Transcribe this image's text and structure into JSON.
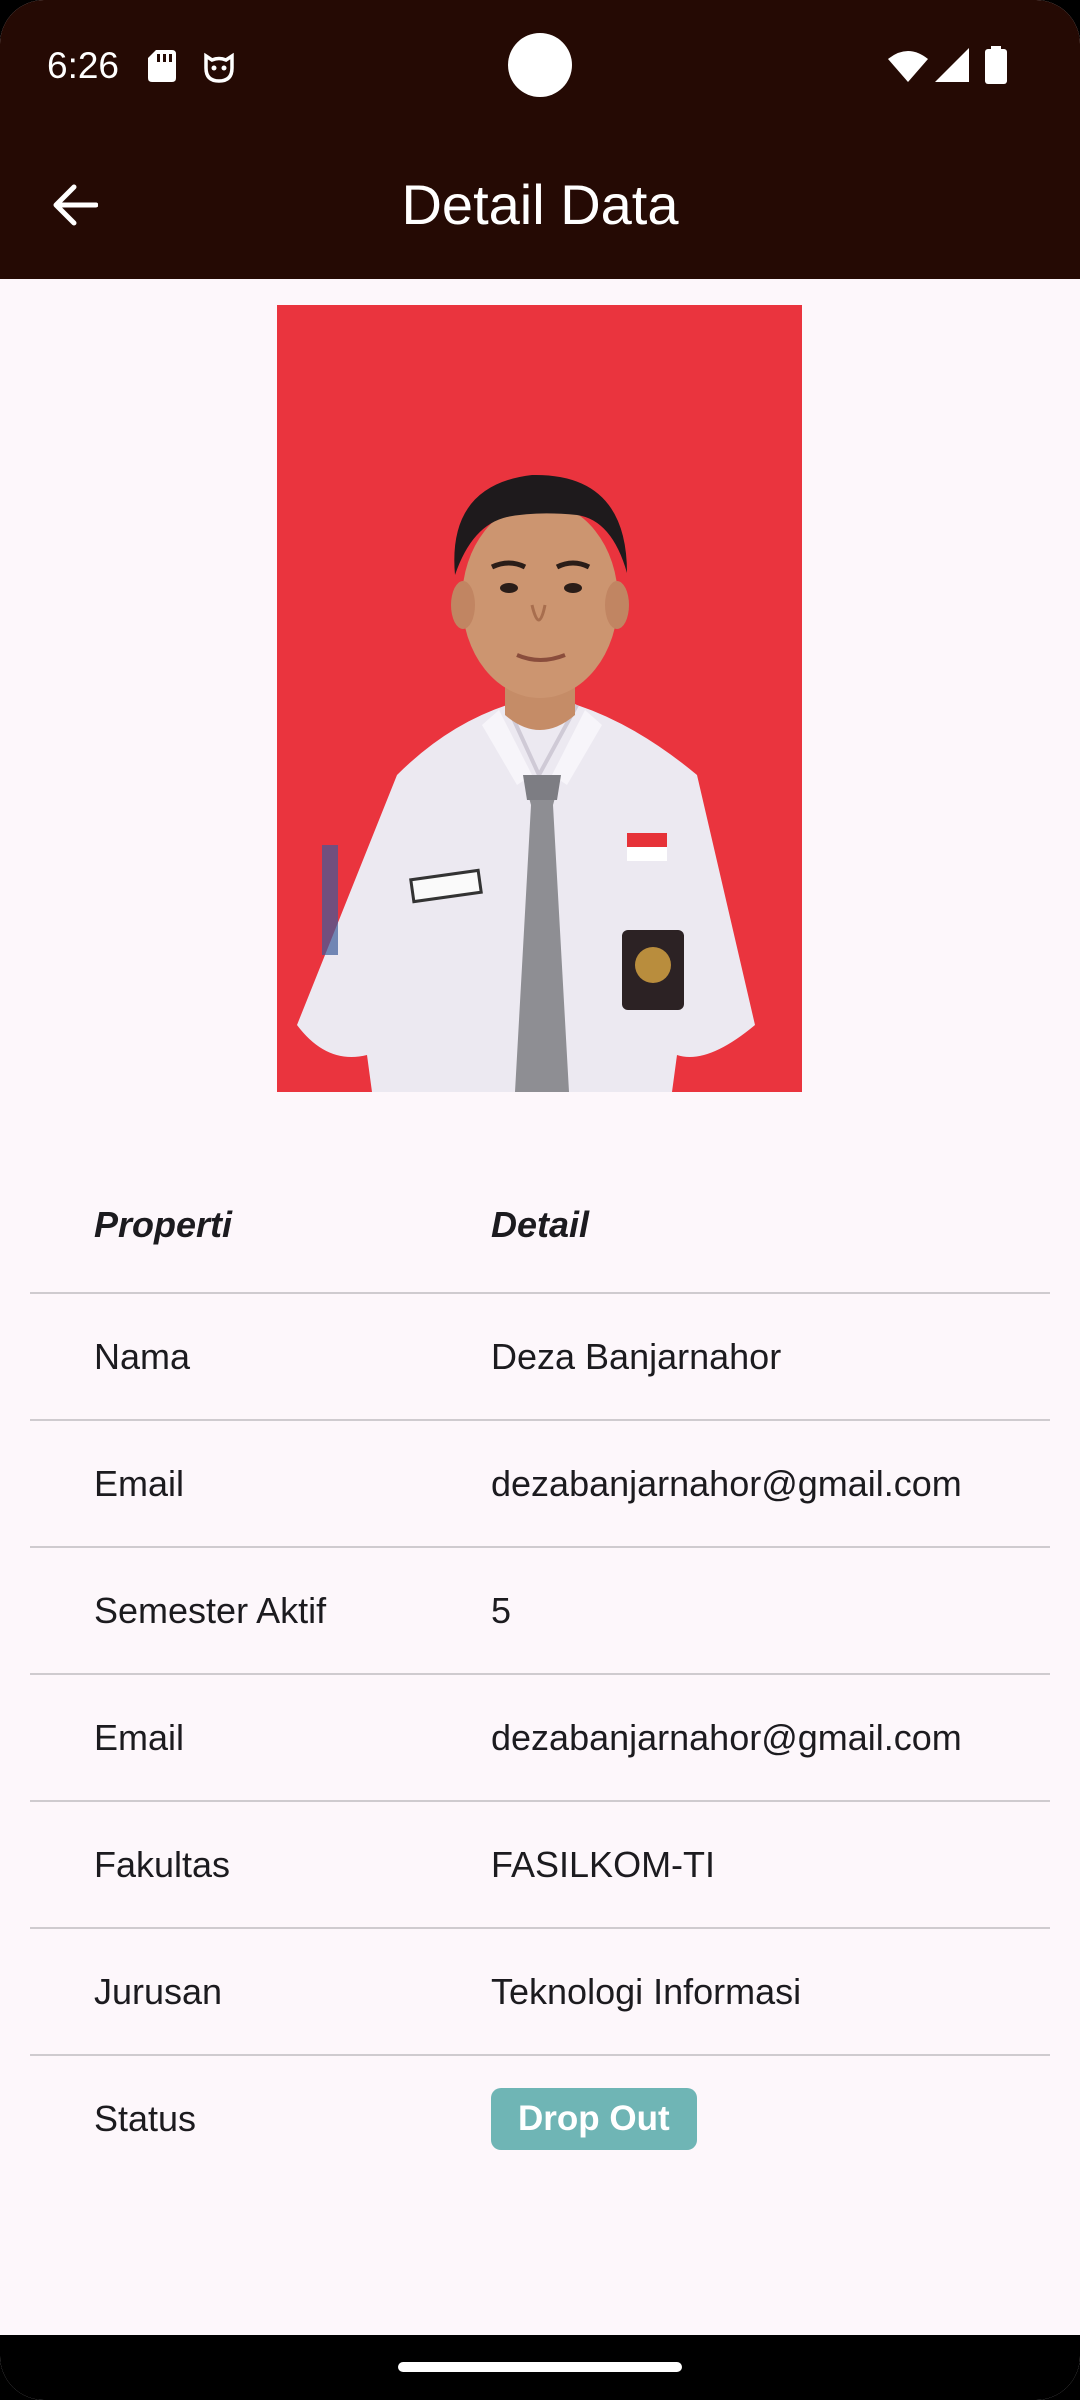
{
  "status_bar": {
    "time": "6:26",
    "icons": [
      "sd-card-icon",
      "cat-icon",
      "wifi-icon",
      "signal-icon",
      "battery-icon"
    ]
  },
  "app_bar": {
    "title": "Detail Data",
    "back_icon": "arrow-left-icon",
    "background": "#250a04"
  },
  "profile_photo": {
    "background": "#ea343e"
  },
  "table": {
    "header": {
      "property": "Properti",
      "detail": "Detail"
    },
    "rows": [
      {
        "property": "Nama",
        "value": "Deza Banjarnahor"
      },
      {
        "property": "Email",
        "value": "dezabanjarnahor@gmail.com"
      },
      {
        "property": "Semester Aktif",
        "value": "5"
      },
      {
        "property": "Email",
        "value": "dezabanjarnahor@gmail.com"
      },
      {
        "property": "Fakultas",
        "value": "FASILKOM-TI"
      },
      {
        "property": "Jurusan",
        "value": "Teknologi Informasi"
      },
      {
        "property": "Status",
        "value": "Drop Out",
        "badge_color": "#6fb5b5"
      }
    ]
  }
}
